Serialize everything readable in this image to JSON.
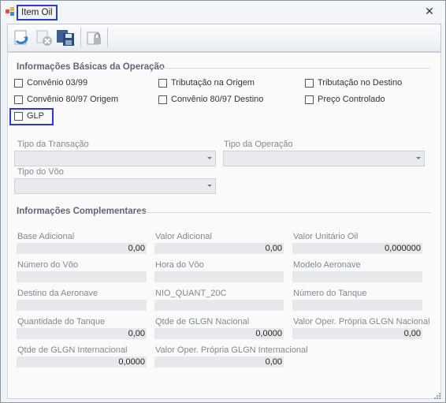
{
  "window": {
    "title": "Item Oil",
    "close_glyph": "✕"
  },
  "toolbar": {
    "buttons": [
      {
        "name": "undo-icon"
      },
      {
        "name": "cancel-icon"
      },
      {
        "name": "save-icon"
      },
      {
        "name": "lock-icon"
      }
    ]
  },
  "basic": {
    "title": "Informações Básicas da Operação",
    "checkboxes": {
      "convenio_03_99": "Convênio 03/99",
      "tributacao_origem": "Tributação na Origem",
      "tributacao_destino": "Tributação no Destino",
      "convenio_80_97_origem": "Convênio 80/97 Origem",
      "convenio_80_97_destino": "Convênio 80/97 Destino",
      "preco_controlado": "Preço Controlado",
      "glp": "GLP"
    },
    "tipo_transacao": "Tipo da Transação",
    "tipo_operacao": "Tipo da Operação",
    "tipo_voo": "Tipo do Vôo"
  },
  "complement": {
    "title": "Informações Complementares",
    "fields": {
      "base_adicional": {
        "label": "Base Adicional",
        "value": "0,00"
      },
      "valor_adicional": {
        "label": "Valor Adicional",
        "value": "0,00"
      },
      "valor_unitario_oil": {
        "label": "Valor Unitário Oil",
        "value": "0,000000"
      },
      "numero_voo": {
        "label": "Número do Vôo",
        "value": ""
      },
      "hora_voo": {
        "label": "Hora do Vôo",
        "value": ""
      },
      "modelo_aeronave": {
        "label": "Modelo Aeronave",
        "value": ""
      },
      "destino_aeronave": {
        "label": "Destino da Aeronave",
        "value": ""
      },
      "nio_quant": {
        "label": "NIO_QUANT_20C",
        "value": ""
      },
      "numero_tanque": {
        "label": "Número do Tanque",
        "value": ""
      },
      "quantidade_tanque": {
        "label": "Quantidade do Tanque",
        "value": "0,00"
      },
      "qtde_glgn_nacional": {
        "label": "Qtde de GLGN Nacional",
        "value": "0,0000"
      },
      "valor_oper_nacional": {
        "label": "Valor Oper. Própria GLGN Nacional",
        "value": "0,00"
      },
      "qtde_glgn_internacional": {
        "label": "Qtde de GLGN Internacional",
        "value": "0,0000"
      },
      "valor_oper_internacional": {
        "label": "Valor Oper. Própria GLGN Internacional",
        "value": "0,00"
      }
    }
  },
  "colors": {
    "highlight": "#2b3bd0",
    "field_bg": "#e6e8eb",
    "section_text": "#5d6673"
  }
}
